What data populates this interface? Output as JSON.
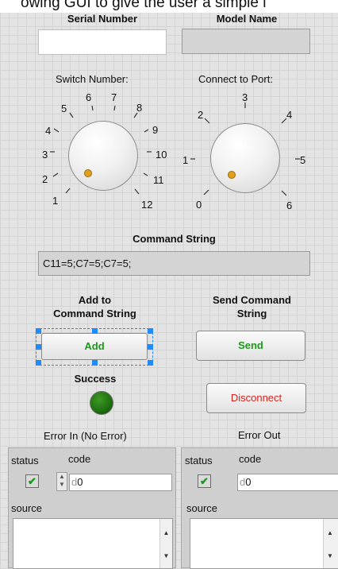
{
  "caption": "owing GUI to give the user a simple i",
  "serial_number": {
    "label": "Serial Number",
    "value": ""
  },
  "model_name": {
    "label": "Model Name",
    "value": ""
  },
  "switch_knob": {
    "label": "Switch Number:",
    "ticks": [
      "1",
      "2",
      "3",
      "4",
      "5",
      "6",
      "7",
      "8",
      "9",
      "10",
      "11",
      "12"
    ],
    "value": 1
  },
  "port_knob": {
    "label": "Connect to Port:",
    "ticks": [
      "0",
      "1",
      "2",
      "3",
      "4",
      "5",
      "6"
    ],
    "value": 0
  },
  "command": {
    "label": "Command String",
    "value": "C11=5;C7=5;C7=5;"
  },
  "add": {
    "header": "Add to Command String",
    "header_line1": "Add to",
    "header_line2": "Command String",
    "button": "Add"
  },
  "send": {
    "header": "Send Command String",
    "header_line1": "Send Command",
    "header_line2": "String",
    "button": "Send"
  },
  "success": {
    "label": "Success"
  },
  "disconnect": {
    "button": "Disconnect"
  },
  "error_in": {
    "title": "Error In (No Error)",
    "status_label": "status",
    "code_label": "code",
    "code_value": "0",
    "code_prefix": "d",
    "source_label": "source"
  },
  "error_out": {
    "title": "Error Out",
    "status_label": "status",
    "code_label": "code",
    "code_value": "0",
    "code_prefix": "d",
    "source_label": "source"
  },
  "colors": {
    "accent_green": "#1a9a1a",
    "disconnect_red": "#d8221e",
    "led_green": "#1f6f10",
    "selection_blue": "#1e8cff"
  }
}
